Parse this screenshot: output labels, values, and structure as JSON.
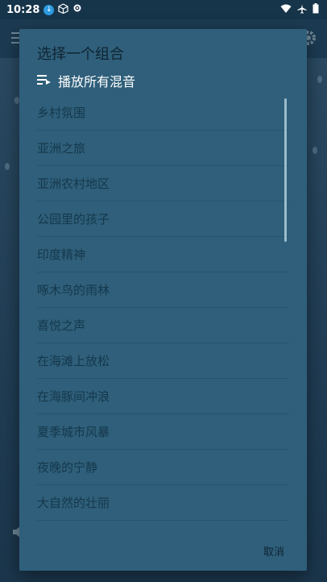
{
  "status_bar": {
    "time": "10:28",
    "icons": [
      "download-icon",
      "cube-icon",
      "settings-gear-icon",
      "wifi-icon",
      "airplane-icon",
      "battery-icon"
    ]
  },
  "dialog": {
    "title": "选择一个组合",
    "play_all_label": "播放所有混音",
    "play_all_icon": "playlist-play-icon",
    "cancel_label": "取消",
    "items": [
      "乡村氛围",
      "亚洲之旅",
      "亚洲农村地区",
      "公园里的孩子",
      "印度精神",
      "啄木鸟的雨林",
      "喜悦之声",
      "在海滩上放松",
      "在海豚间冲浪",
      "夏季城市风暴",
      "夜晚的宁静",
      "大自然的壮丽"
    ]
  },
  "colors": {
    "dialog_bg": "#2f5f7a",
    "title_text": "#0f2433",
    "item_text": "#15384c",
    "play_all_text": "#ffffff"
  }
}
